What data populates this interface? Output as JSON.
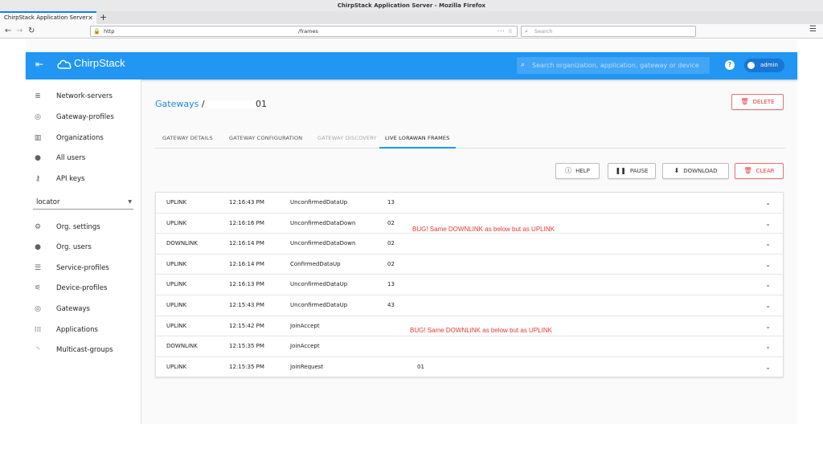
{
  "browser": {
    "window_title": "ChirpStack Application Server - Mozilla Firefox",
    "tab_title": "ChirpStack Application Server",
    "tab_close": "✕",
    "new_tab": "+",
    "url_prefix": "http",
    "url_suffix": "/frames",
    "url_tools": "···  ☆",
    "search_placeholder": "Search"
  },
  "app": {
    "brand": "ChirpStack",
    "search_placeholder": "Search organization, application, gateway or device",
    "user": "admin",
    "colors": {
      "primary": "#2196f3",
      "danger": "#e53935"
    }
  },
  "sidebar": {
    "global_items": [
      {
        "label": "Network-servers",
        "icon": "server-icon"
      },
      {
        "label": "Gateway-profiles",
        "icon": "radio-tower-icon"
      },
      {
        "label": "Organizations",
        "icon": "domain-icon"
      },
      {
        "label": "All users",
        "icon": "account-icon"
      },
      {
        "label": "API keys",
        "icon": "key-icon"
      }
    ],
    "org_select": "locator",
    "org_items": [
      {
        "label": "Org. settings",
        "icon": "gear-icon"
      },
      {
        "label": "Org. users",
        "icon": "account-icon"
      },
      {
        "label": "Service-profiles",
        "icon": "account-details-icon"
      },
      {
        "label": "Device-profiles",
        "icon": "tune-icon"
      },
      {
        "label": "Gateways",
        "icon": "radio-tower-icon"
      },
      {
        "label": "Applications",
        "icon": "apps-icon"
      },
      {
        "label": "Multicast-groups",
        "icon": "rss-icon"
      }
    ]
  },
  "main": {
    "breadcrumb": {
      "root": "Gateways",
      "separator": "/",
      "current": "01"
    },
    "delete_label": "DELETE",
    "tabs": [
      {
        "label": "GATEWAY DETAILS",
        "state": "normal"
      },
      {
        "label": "GATEWAY CONFIGURATION",
        "state": "normal"
      },
      {
        "label": "GATEWAY DISCOVERY",
        "state": "disabled"
      },
      {
        "label": "LIVE LORAWAN FRAMES",
        "state": "active"
      }
    ],
    "actions": {
      "help": "HELP",
      "pause": "PAUSE",
      "download": "DOWNLOAD",
      "clear": "CLEAR"
    },
    "frames": [
      {
        "direction": "UPLINK",
        "time": "12:16:43 PM",
        "mtype": "UnconfirmedDataUp",
        "addr": "13"
      },
      {
        "direction": "UPLINK",
        "time": "12:16:16 PM",
        "mtype": "UnconfirmedDataDown",
        "addr": "02"
      },
      {
        "direction": "DOWNLINK",
        "time": "12:16:14 PM",
        "mtype": "UnconfirmedDataDown",
        "addr": "02"
      },
      {
        "direction": "UPLINK",
        "time": "12:16:14 PM",
        "mtype": "ConfirmedDataUp",
        "addr": "02"
      },
      {
        "direction": "UPLINK",
        "time": "12:16:13 PM",
        "mtype": "UnconfirmedDataUp",
        "addr": "13"
      },
      {
        "direction": "UPLINK",
        "time": "12:15:43 PM",
        "mtype": "UnconfirmedDataUp",
        "addr": "43"
      },
      {
        "direction": "UPLINK",
        "time": "12:15:42 PM",
        "mtype": "JoinAccept",
        "addr": ""
      },
      {
        "direction": "DOWNLINK",
        "time": "12:15:35 PM",
        "mtype": "JoinAccept",
        "addr": ""
      },
      {
        "direction": "UPLINK",
        "time": "12:15:35 PM",
        "mtype": "JoinRequest",
        "addr": "01"
      }
    ],
    "annotations": [
      "BUG! Same DOWNLINK as below but as UPLINK",
      "BUG! Same DOWNLINK as below but as UPLINK"
    ]
  }
}
